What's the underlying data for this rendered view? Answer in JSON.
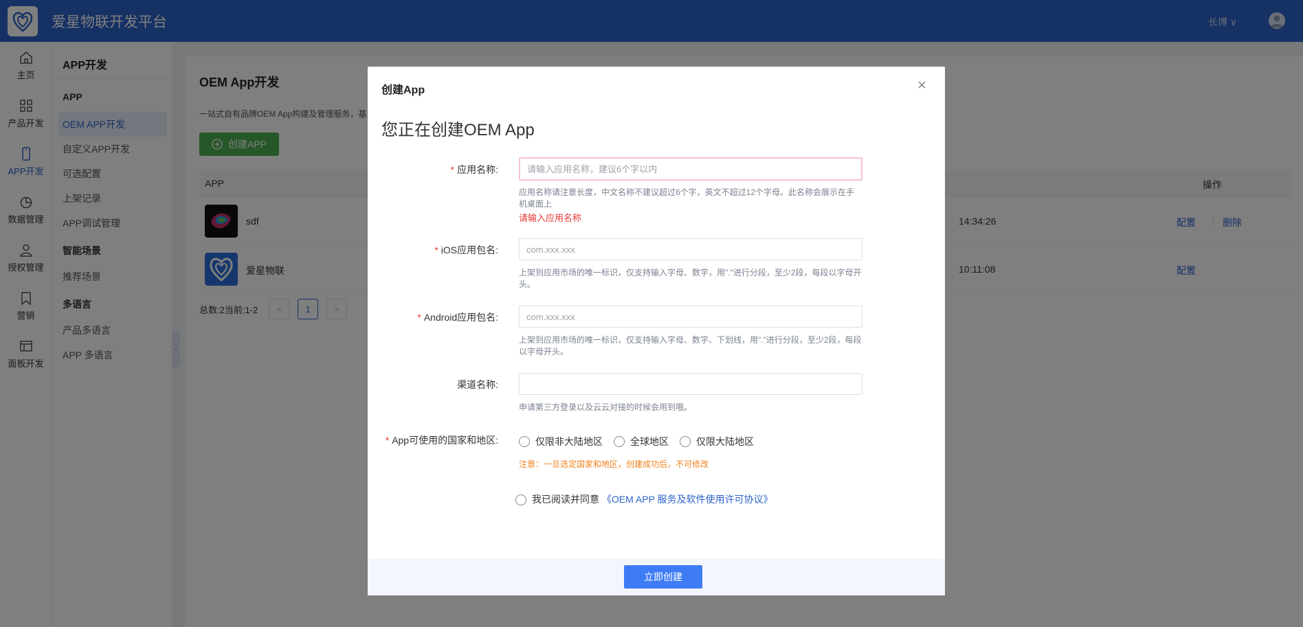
{
  "header": {
    "brand": "爱星物联开发平台",
    "user": "长博 ∨"
  },
  "rail": [
    {
      "label": "主页",
      "icon": "home-icon"
    },
    {
      "label": "产品开发",
      "icon": "grid-icon"
    },
    {
      "label": "APP开发",
      "icon": "phone-icon"
    },
    {
      "label": "数据管理",
      "icon": "pie-chart-icon"
    },
    {
      "label": "授权管理",
      "icon": "user-icon"
    },
    {
      "label": "营销",
      "icon": "bookmark-icon"
    },
    {
      "label": "面板开发",
      "icon": "panel-icon"
    }
  ],
  "submenu": {
    "title": "APP开发",
    "items": [
      {
        "label": "APP",
        "group": true
      },
      {
        "label": "OEM APP开发",
        "active": true
      },
      {
        "label": "自定义APP开发"
      },
      {
        "label": "可选配置"
      },
      {
        "label": "上架记录"
      },
      {
        "label": "APP调试管理"
      },
      {
        "label": "智能场景",
        "group": true
      },
      {
        "label": "推荐场景"
      },
      {
        "label": "多语言",
        "group": true
      },
      {
        "label": "产品多语言"
      },
      {
        "label": "APP 多语言"
      }
    ]
  },
  "main": {
    "title": "OEM App开发",
    "desc": "一站式自有品牌OEM App构建及管理服务，基",
    "create_label": "创建APP",
    "columns": {
      "app": "APP",
      "ops": "操作"
    },
    "rows": [
      {
        "name": "sdf",
        "time": "14:34:26",
        "config": "配置",
        "delete": "删除"
      },
      {
        "name": "爱星物联",
        "time": "10:11:08",
        "config": "配置"
      }
    ],
    "pager": {
      "info": "总数:2当前:1-2",
      "prev": "<",
      "page": "1",
      "next": ">"
    }
  },
  "dialog": {
    "title": "创建App",
    "close": "×",
    "heading": "您正在创建OEM App",
    "fields": {
      "app_name": {
        "label": "应用名称:",
        "placeholder": "请输入应用名称，建议6个字以内",
        "hint": "应用名称请注意长度，中文名称不建议超过6个字，英文不超过12个字母。此名称会展示在手机桌面上",
        "error": "请输入应用名称"
      },
      "ios_bundle": {
        "label": "iOS应用包名:",
        "placeholder": "com.xxx.xxx",
        "hint": "上架到应用市场的唯一标识，仅支持输入字母、数字，用\".\"进行分段，至少2段，每段以字母开头。"
      },
      "android_bundle": {
        "label": "Android应用包名:",
        "placeholder": "com.xxx.xxx",
        "hint": "上架到应用市场的唯一标识，仅支持输入字母、数字、下划线，用\".\"进行分段，至少2段，每段以字母开头。"
      },
      "channel": {
        "label": "渠道名称:",
        "placeholder": "",
        "hint": "申请第三方登录以及云云对接的时候会用到哦。"
      },
      "region": {
        "label": "App可使用的国家和地区:",
        "options": [
          "仅限非大陆地区",
          "全球地区",
          "仅限大陆地区"
        ],
        "warning": "注意：一旦选定国家和地区，创建成功后，不可修改"
      }
    },
    "agreement": {
      "text": "我已阅读并同意",
      "link": "《OEM APP 服务及软件使用许可协议》"
    },
    "submit": "立即创建"
  }
}
